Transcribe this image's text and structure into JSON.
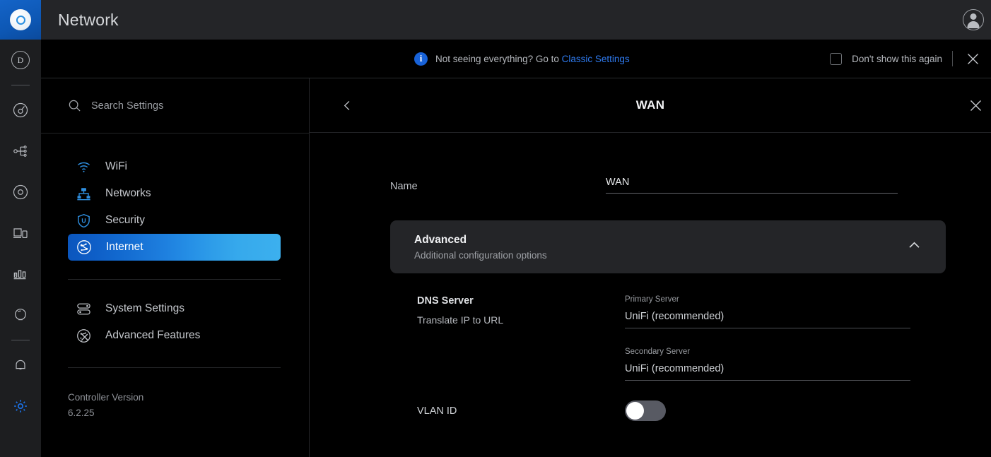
{
  "app": {
    "logo_icon": "unifi-ap-logo",
    "title": "Network"
  },
  "rail": {
    "items": [
      {
        "icon": "user-avatar-d-icon",
        "label": "D"
      },
      {
        "icon": "dashboard-gauge-icon",
        "label": ""
      },
      {
        "icon": "topology-icon",
        "label": ""
      },
      {
        "icon": "wifi-circle-icon",
        "label": ""
      },
      {
        "icon": "devices-icon",
        "label": ""
      },
      {
        "icon": "statistics-bar-icon",
        "label": ""
      },
      {
        "icon": "insights-icon",
        "label": ""
      },
      {
        "icon": "notifications-bell-icon",
        "label": ""
      },
      {
        "icon": "gear-icon",
        "label": ""
      }
    ],
    "active_icon": "gear-icon",
    "active_color": "#1b72e8"
  },
  "topbar": {
    "title": "Network",
    "avatar_icon": "account-avatar"
  },
  "banner": {
    "info_icon": "info-icon",
    "info_glyph": "i",
    "message": "Not seeing everything? Go to",
    "link_label": "Classic Settings",
    "link_color": "#2f7bf0",
    "checkbox_label": "Don't show this again",
    "checkbox_checked": false,
    "close_icon": "close-icon"
  },
  "sidebar": {
    "search": {
      "icon": "search-icon",
      "placeholder": "Search Settings"
    },
    "items": [
      {
        "label": "WiFi",
        "icon": "wifi-icon",
        "active": false
      },
      {
        "label": "Networks",
        "icon": "networks-icon",
        "active": false
      },
      {
        "label": "Security",
        "icon": "shield-icon",
        "active": false
      },
      {
        "label": "Internet",
        "icon": "globe-icon",
        "active": true
      }
    ],
    "items2": [
      {
        "label": "System Settings",
        "icon": "sliders-icon"
      },
      {
        "label": "Advanced Features",
        "icon": "advanced-globe-icon"
      }
    ],
    "version": {
      "label": "Controller Version",
      "value": "6.2.25"
    },
    "highlight_from": "#0b56bd",
    "highlight_to": "#3cb0ee"
  },
  "main": {
    "back_icon": "chevron-left-icon",
    "title": "WAN",
    "close_icon": "close-icon",
    "name_field": {
      "label": "Name",
      "value": "WAN"
    },
    "advanced": {
      "title": "Advanced",
      "subtitle": "Additional configuration options",
      "chevron_icon": "chevron-up-icon",
      "expanded": true
    },
    "dns": {
      "title": "DNS Server",
      "subtitle": "Translate IP to URL",
      "primary": {
        "label": "Primary Server",
        "value": "UniFi (recommended)"
      },
      "secondary": {
        "label": "Secondary Server",
        "value": "UniFi (recommended)"
      }
    },
    "vlan": {
      "label": "VLAN ID",
      "toggle_on": false
    }
  }
}
